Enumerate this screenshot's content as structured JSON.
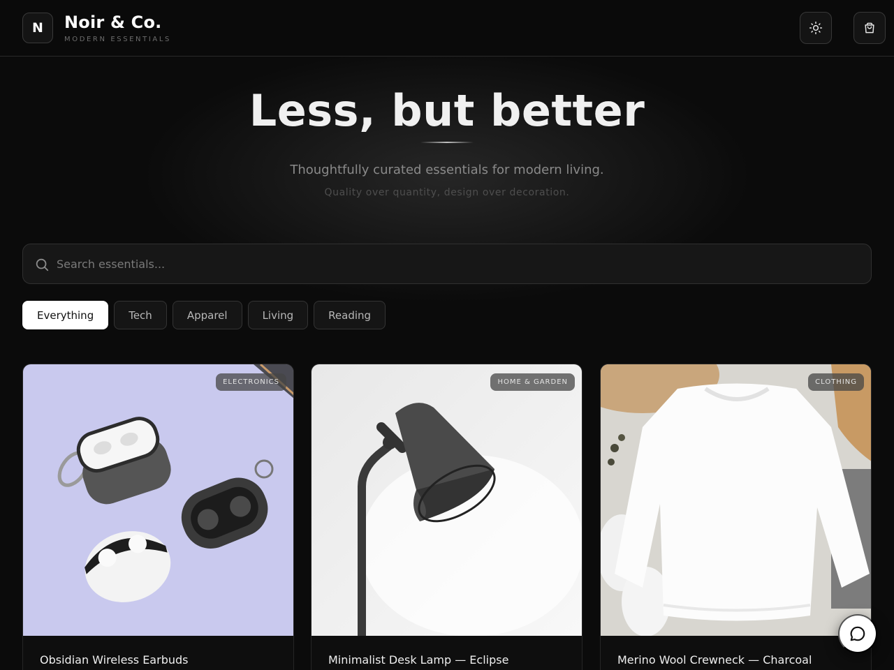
{
  "header": {
    "logo_letter": "N",
    "brand_name": "Noir & Co.",
    "brand_tagline": "MODERN ESSENTIALS",
    "theme_icon": "sun-icon",
    "cart_icon": "shopping-bag-icon"
  },
  "hero": {
    "title": "Less, but better",
    "subtitle": "Thoughtfully curated essentials for modern living.",
    "tagline": "Quality over quantity, design over decoration."
  },
  "search": {
    "icon": "search-icon",
    "placeholder": "Search essentials..."
  },
  "filters": {
    "chips": [
      {
        "label": "Everything",
        "active": true
      },
      {
        "label": "Tech",
        "active": false
      },
      {
        "label": "Apparel",
        "active": false
      },
      {
        "label": "Living",
        "active": false
      },
      {
        "label": "Reading",
        "active": false
      }
    ]
  },
  "products": [
    {
      "badge": "ELECTRONICS",
      "name": "Obsidian Wireless Earbuds"
    },
    {
      "badge": "HOME & GARDEN",
      "name": "Minimalist Desk Lamp — Eclipse"
    },
    {
      "badge": "CLOTHING",
      "name": "Merino Wool Crewneck — Charcoal"
    }
  ],
  "chat": {
    "icon": "chat-bubble-icon"
  },
  "colors": {
    "background": "#0b0b0b",
    "accent": "#ffffff",
    "card_1_bg": "#c8c8ec",
    "card_2_bg": "#ededed",
    "card_3_bg": "#d9d7d2"
  }
}
